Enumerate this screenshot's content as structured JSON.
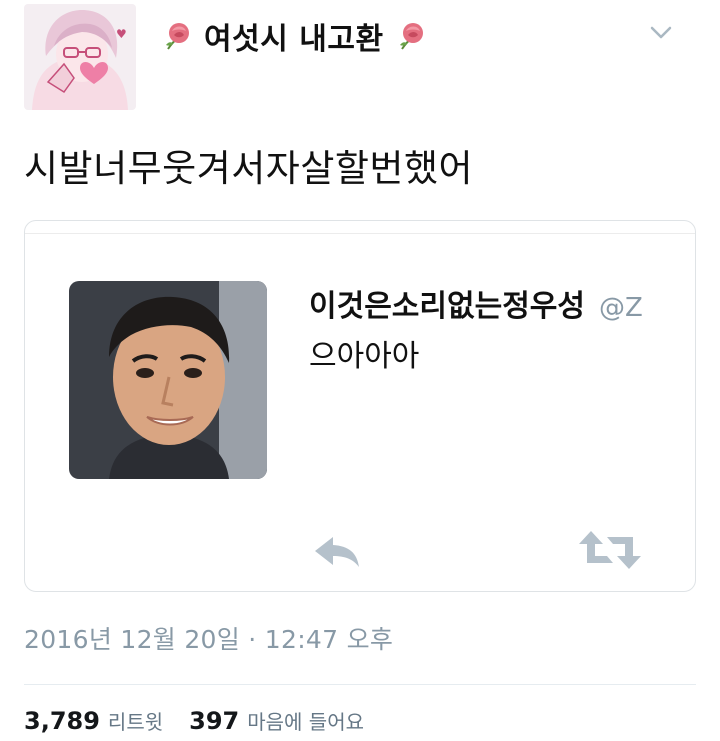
{
  "author": {
    "display_name": "여섯시 내고환",
    "avatar_icon": "anime-avatar-icon",
    "decoration_icon": "rose-icon"
  },
  "tweet": {
    "text": "시발너무웃겨서자살할번했어",
    "menu_icon": "chevron-down-icon"
  },
  "quoted_tweet": {
    "name": "이것은소리없는정우성",
    "handle": "@Z",
    "text": "으아아아",
    "photo_icon": "profile-photo-icon",
    "reply_icon": "reply-icon",
    "retweet_icon": "retweet-icon"
  },
  "meta": {
    "timestamp": "2016년 12월 20일 · 12:47 오후"
  },
  "stats": {
    "retweets_count": "3,789",
    "retweets_label": "리트윗",
    "likes_count": "397",
    "likes_label": "마음에 들어요"
  },
  "colors": {
    "text_primary": "#14171a",
    "text_secondary": "#8899a6",
    "border": "#dfe3e6",
    "rose": "#e26d7c"
  }
}
